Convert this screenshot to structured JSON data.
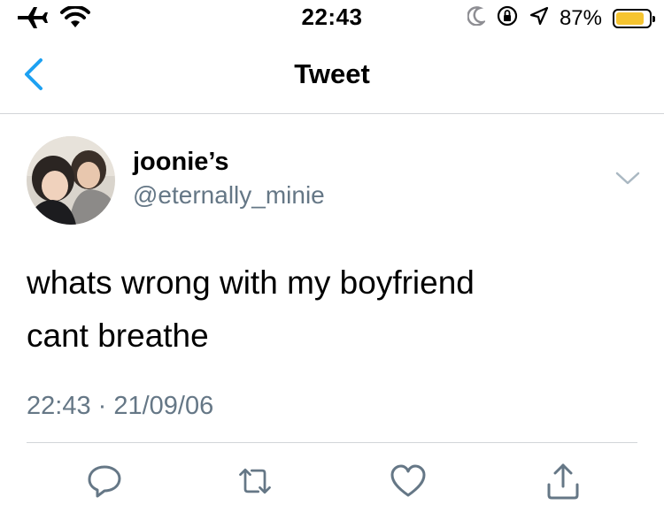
{
  "status_bar": {
    "time": "22:43",
    "battery_percent": "87%",
    "battery_level": 0.87,
    "battery_color": "#f5c430",
    "left_icons": [
      "airplane-icon",
      "wifi-icon"
    ],
    "right_icons": [
      "moon-icon",
      "orientation-lock-icon",
      "location-arrow-icon"
    ]
  },
  "nav": {
    "title": "Tweet",
    "back_icon": "chevron-left-icon",
    "accent_color": "#1da1f2"
  },
  "tweet": {
    "display_name": "joonie’s",
    "handle": "@eternally_minie",
    "text_lines": [
      "whats wrong with my boyfriend",
      "cant breathe"
    ],
    "timestamp": "22:43 · 21/09/06",
    "more_icon": "chevron-down-icon"
  },
  "actions": [
    {
      "name": "reply",
      "icon": "reply-bubble-icon"
    },
    {
      "name": "retweet",
      "icon": "retweet-icon"
    },
    {
      "name": "like",
      "icon": "heart-icon"
    },
    {
      "name": "share",
      "icon": "share-icon"
    }
  ],
  "colors": {
    "secondary_text": "#657786",
    "divider": "#d2d5d8",
    "icon_gray": "#657786"
  }
}
